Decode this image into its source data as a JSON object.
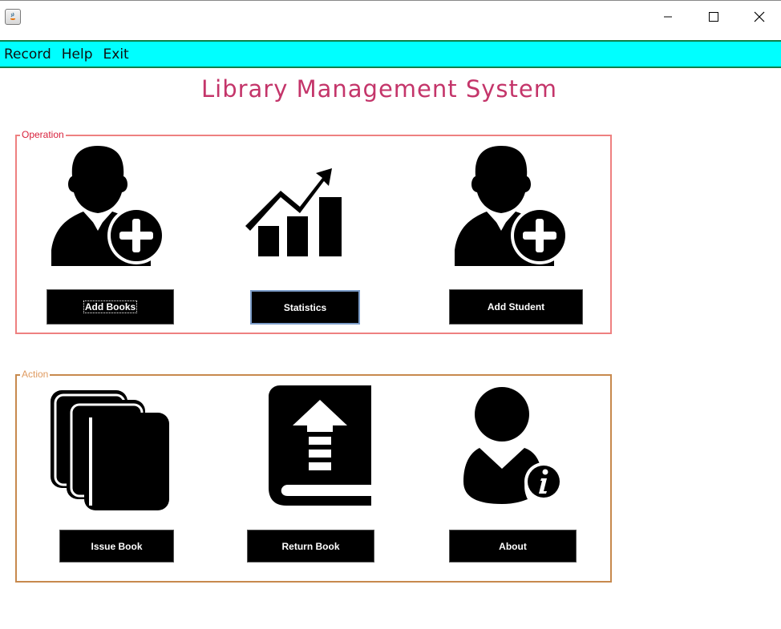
{
  "window": {
    "controls": [
      "minimize",
      "maximize",
      "close"
    ]
  },
  "menu": [
    {
      "label": "Record"
    },
    {
      "label": "Help"
    },
    {
      "label": "Exit"
    }
  ],
  "app_title": "Library Management System",
  "operation": {
    "label": "Operation",
    "buttons": {
      "add_books": "Add Books",
      "statistics": "Statistics",
      "add_student": "Add Student"
    }
  },
  "action": {
    "label": "Action",
    "buttons": {
      "issue_book": "Issue Book",
      "return_book": "Return Book",
      "about": "About"
    }
  },
  "icons": {
    "add_books": "user-add-icon",
    "statistics": "chart-growth-icon",
    "add_student": "user-add-icon",
    "issue_book": "books-stack-icon",
    "return_book": "book-upload-icon",
    "about": "user-info-icon"
  },
  "colors": {
    "menu_bg": "#00ffff",
    "title": "#c4356a",
    "operation_border": "#ee8080",
    "action_border": "#c7894d"
  }
}
